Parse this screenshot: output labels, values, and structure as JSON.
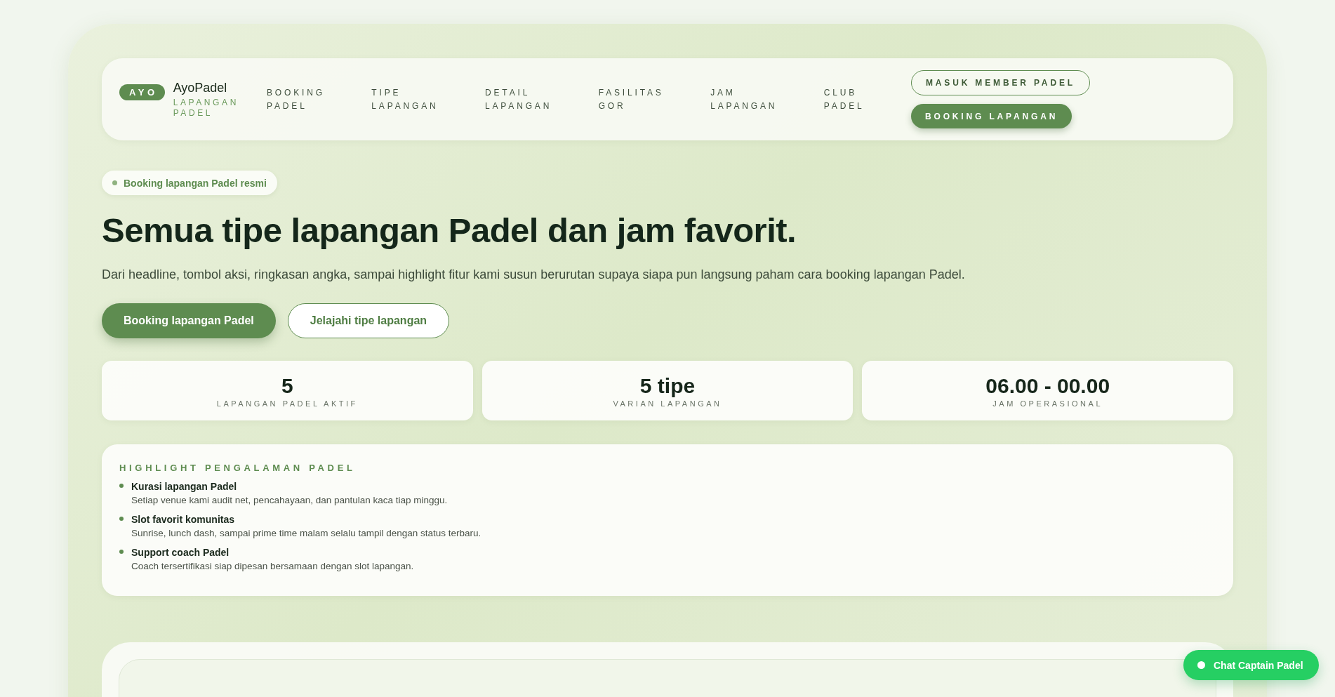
{
  "brand": {
    "badge": "AYO",
    "name": "AyoPadel",
    "tagline": "LAPANGAN PADEL"
  },
  "nav": [
    "BOOKING PADEL",
    "TIPE LAPANGAN",
    "DETAIL LAPANGAN",
    "FASILITAS GOR",
    "JAM LAPANGAN",
    "CLUB PADEL"
  ],
  "header_buttons": [
    {
      "label": "MASUK MEMBER PADEL",
      "kind": "outline"
    },
    {
      "label": "BOOKING LAPANGAN",
      "kind": "filled"
    }
  ],
  "hero": {
    "badge": "Booking lapangan Padel resmi",
    "title": "Semua tipe lapangan Padel dan jam favorit.",
    "description": "Dari headline, tombol aksi, ringkasan angka, sampai highlight fitur kami susun berurutan supaya siapa pun langsung paham cara booking lapangan Padel.",
    "buttons": [
      {
        "label": "Booking lapangan Padel",
        "kind": "filled"
      },
      {
        "label": "Jelajahi tipe lapangan",
        "kind": "outline"
      }
    ]
  },
  "stats": [
    {
      "value": "5",
      "label": "LAPANGAN PADEL AKTIF"
    },
    {
      "value": "5 tipe",
      "label": "VARIAN LAPANGAN"
    },
    {
      "value": "06.00 - 00.00",
      "label": "JAM OPERASIONAL"
    }
  ],
  "highlights": {
    "title": "HIGHLIGHT PENGALAMAN PADEL",
    "items": [
      {
        "title": "Kurasi lapangan Padel",
        "text": "Setiap venue kami audit net, pencahayaan, dan pantulan kaca tiap minggu."
      },
      {
        "title": "Slot favorit komunitas",
        "text": "Sunrise, lunch dash, sampai prime time malam selalu tampil dengan status terbaru."
      },
      {
        "title": "Support coach Padel",
        "text": "Coach tersertifikasi siap dipesan bersamaan dengan slot lapangan."
      }
    ]
  },
  "chat_button": "Chat Captain Padel"
}
